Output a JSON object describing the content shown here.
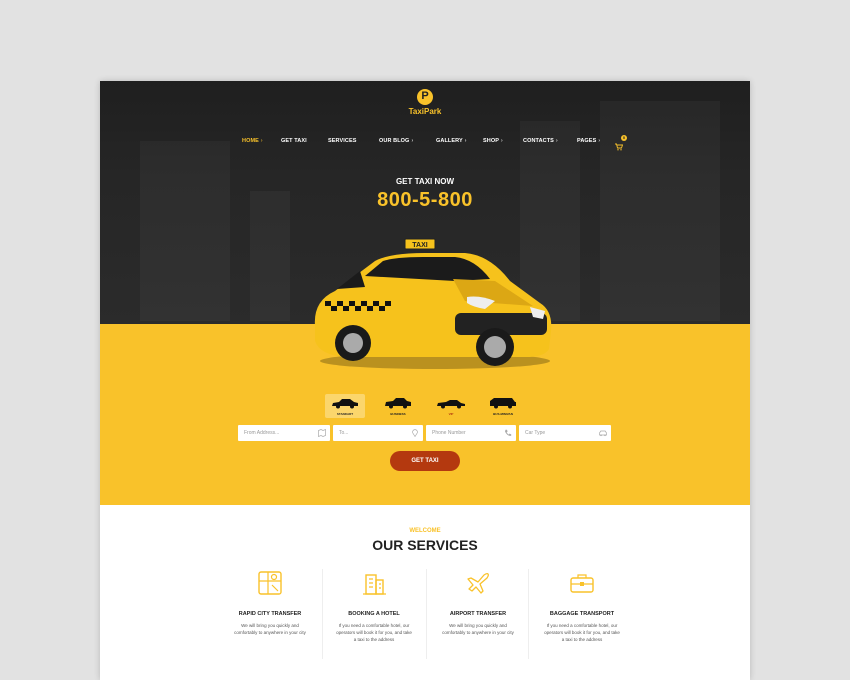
{
  "brand": {
    "logo_letter": "P",
    "name": "TaxiPark"
  },
  "nav": {
    "items": [
      {
        "label": "HOME",
        "active": true
      },
      {
        "label": "GET TAXI",
        "active": false
      },
      {
        "label": "SERVICES",
        "active": false
      },
      {
        "label": "OUR BLOG",
        "active": false
      },
      {
        "label": "GALLERY",
        "active": false
      },
      {
        "label": "SHOP",
        "active": false
      },
      {
        "label": "CONTACTS",
        "active": false
      },
      {
        "label": "PAGES",
        "active": false
      }
    ],
    "cart_icon": "cart-icon",
    "cart_count": "0"
  },
  "hero": {
    "subtitle": "GET TAXI NOW",
    "phone": "800-5-800",
    "taxi_sign": "TAXI"
  },
  "booking": {
    "car_types": [
      {
        "label": "STANDART",
        "selected": true
      },
      {
        "label": "BUSINESS",
        "selected": false
      },
      {
        "label": "VIP",
        "selected": false
      },
      {
        "label": "BUS-MINIVAN",
        "selected": false
      }
    ],
    "fields": [
      {
        "placeholder": "From Address...",
        "icon": "map-icon"
      },
      {
        "placeholder": "To...",
        "icon": "pin-icon"
      },
      {
        "placeholder": "Phone Number",
        "icon": "phone-icon"
      },
      {
        "placeholder": "Car Type",
        "icon": "car-icon"
      }
    ],
    "submit_label": "GET TAXI"
  },
  "services": {
    "kicker": "WELCOME",
    "title": "OUR SERVICES",
    "items": [
      {
        "title": "RAPID CITY TRANSFER",
        "text": "We will bring you quickly and comfortably to anywhere in your city",
        "icon": "city-map-icon"
      },
      {
        "title": "BOOKING A HOTEL",
        "text": "If you need a comfortable hotel, our operators will book it for you, and take a taxi to the address",
        "icon": "hotel-icon"
      },
      {
        "title": "AIRPORT TRANSFER",
        "text": "We will bring you quickly and comfortably to anywhere in your city",
        "icon": "airplane-icon"
      },
      {
        "title": "BAGGAGE TRANSPORT",
        "text": "If you need a comfortable hotel, our operators will book it for you, and take a taxi to the address",
        "icon": "suitcase-icon"
      }
    ]
  },
  "colors": {
    "accent": "#f9c22a",
    "dark": "#262626",
    "button": "#b4390f"
  }
}
